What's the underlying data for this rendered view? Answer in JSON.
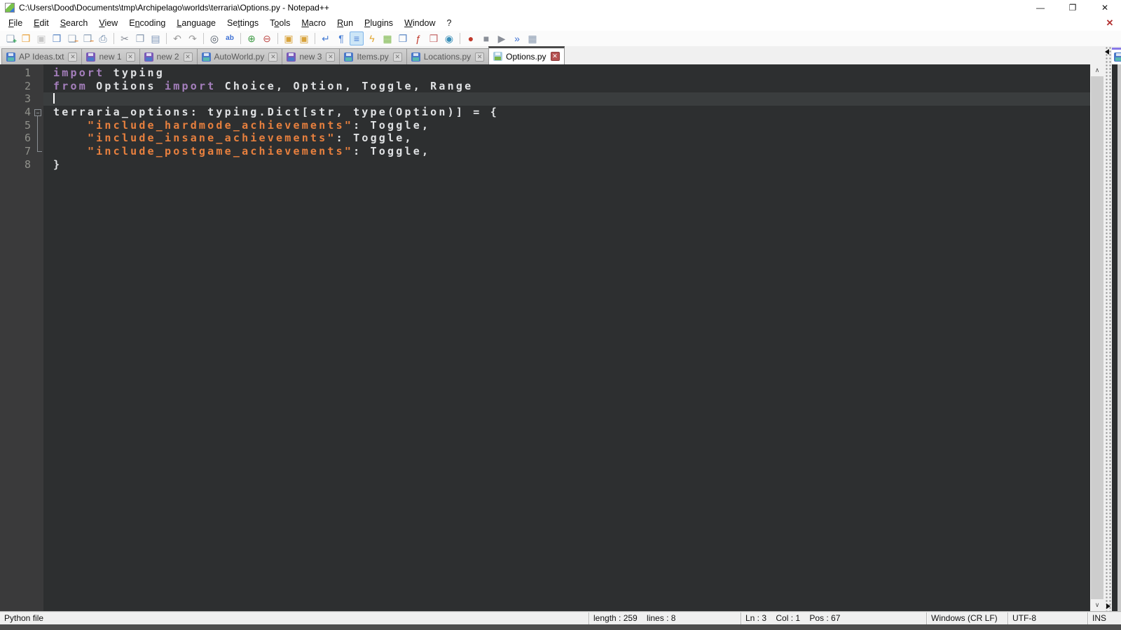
{
  "colors": {
    "editor_bg": "#2d2f30",
    "gutter_bg": "#3a3a3b",
    "caret_line_bg": "#3a3d3e",
    "keyword": "#a57fbd",
    "string": "#e8803e",
    "plain": "#e0e2e4",
    "line_number": "#90918b",
    "active_tab_top": "#4a4a4a",
    "secondary_tab_top": "#8878e8"
  },
  "titlebar": {
    "title": "C:\\Users\\Dood\\Documents\\tmp\\Archipelago\\worlds\\terraria\\Options.py - Notepad++",
    "minimize": "—",
    "restore": "❐",
    "close": "✕"
  },
  "menubar": {
    "items": [
      {
        "label": "File",
        "u": 0
      },
      {
        "label": "Edit",
        "u": 0
      },
      {
        "label": "Search",
        "u": 0
      },
      {
        "label": "View",
        "u": 0
      },
      {
        "label": "Encoding",
        "u": 1
      },
      {
        "label": "Language",
        "u": 0
      },
      {
        "label": "Settings",
        "u": 2
      },
      {
        "label": "Tools",
        "u": 1
      },
      {
        "label": "Macro",
        "u": 0
      },
      {
        "label": "Run",
        "u": 0
      },
      {
        "label": "Plugins",
        "u": 0
      },
      {
        "label": "Window",
        "u": 0
      },
      {
        "label": "?",
        "u": -1
      }
    ],
    "close_doc_glyph": "✕"
  },
  "toolbar": {
    "groups": [
      [
        {
          "name": "new-file-icon",
          "glyph": "❏",
          "color": "#8fa3b8",
          "ov": "+",
          "ovc": "#2fa84f"
        },
        {
          "name": "open-icon",
          "glyph": "❒",
          "color": "#e8a33d"
        },
        {
          "name": "save-icon",
          "glyph": "▣",
          "color": "#a0a0a0",
          "disabled": true
        },
        {
          "name": "save-all-icon",
          "glyph": "❒",
          "color": "#5b87c5"
        },
        {
          "name": "close-icon",
          "glyph": "❏",
          "color": "#8fa3b8",
          "ov": "−",
          "ovc": "#e8872e"
        },
        {
          "name": "close-all-icon",
          "glyph": "❒",
          "color": "#8fa3b8",
          "ov": "−",
          "ovc": "#e8872e"
        },
        {
          "name": "print-icon",
          "glyph": "⎙",
          "color": "#6b87a8"
        }
      ],
      [
        {
          "name": "cut-icon",
          "glyph": "✂",
          "color": "#8a8f98"
        },
        {
          "name": "copy-icon",
          "glyph": "❐",
          "color": "#8a9ab0"
        },
        {
          "name": "paste-icon",
          "glyph": "▤",
          "color": "#7f97b8"
        }
      ],
      [
        {
          "name": "undo-icon",
          "glyph": "↶",
          "color": "#9a9a9a"
        },
        {
          "name": "redo-icon",
          "glyph": "↷",
          "color": "#9a9a9a"
        }
      ],
      [
        {
          "name": "find-icon",
          "glyph": "◎",
          "color": "#4b5563"
        },
        {
          "name": "replace-icon",
          "glyph": "ab",
          "color": "#3b6fd4",
          "small": true
        }
      ],
      [
        {
          "name": "zoom-in-icon",
          "glyph": "⊕",
          "color": "#3f9b46"
        },
        {
          "name": "zoom-out-icon",
          "glyph": "⊖",
          "color": "#c0504d"
        }
      ],
      [
        {
          "name": "sync-vertical-scroll-icon",
          "glyph": "▣",
          "color": "#d8a23a"
        },
        {
          "name": "sync-horizontal-scroll-icon",
          "glyph": "▣",
          "color": "#d8a23a"
        }
      ],
      [
        {
          "name": "word-wrap-icon",
          "glyph": "↵",
          "color": "#4a7fd4"
        },
        {
          "name": "show-all-characters-icon",
          "glyph": "¶",
          "color": "#4a7fd4"
        },
        {
          "name": "indent-guide-icon",
          "glyph": "≡",
          "color": "#4a7fd4",
          "active": true
        },
        {
          "name": "style-configurator-icon",
          "glyph": "ϟ",
          "color": "#e0a52e"
        },
        {
          "name": "document-map-icon",
          "glyph": "▦",
          "color": "#7ab648"
        },
        {
          "name": "doc-switcher-icon",
          "glyph": "❐",
          "color": "#5b87c5"
        },
        {
          "name": "function-list-icon",
          "glyph": "ƒ",
          "color": "#c0392b"
        },
        {
          "name": "folder-as-workspace-icon",
          "glyph": "❒",
          "color": "#c66a6a"
        },
        {
          "name": "monitoring-icon",
          "glyph": "◉",
          "color": "#3a8fb8"
        }
      ],
      [
        {
          "name": "macro-record-icon",
          "glyph": "●",
          "color": "#c0392b"
        },
        {
          "name": "macro-stop-icon",
          "glyph": "■",
          "color": "#8a8f98"
        },
        {
          "name": "macro-play-icon",
          "glyph": "▶",
          "color": "#8a8f98"
        },
        {
          "name": "macro-run-multiple-icon",
          "glyph": "»",
          "color": "#3b6fd4"
        },
        {
          "name": "macro-save-icon",
          "glyph": "▦",
          "color": "#8a9ab0"
        }
      ]
    ]
  },
  "tabbar": {
    "tabs": [
      {
        "label": "AP Ideas.txt",
        "active": false,
        "floppy_body": "#4a78c8",
        "floppy_label": "#58b8b0"
      },
      {
        "label": "new 1",
        "active": false,
        "floppy_body": "#7a5ab8",
        "floppy_label": "#4a78c8"
      },
      {
        "label": "new 2",
        "active": false,
        "floppy_body": "#7a5ab8",
        "floppy_label": "#4a78c8"
      },
      {
        "label": "AutoWorld.py",
        "active": false,
        "floppy_body": "#4a78c8",
        "floppy_label": "#58b8b0"
      },
      {
        "label": "new 3",
        "active": false,
        "floppy_body": "#7a5ab8",
        "floppy_label": "#4a78c8"
      },
      {
        "label": "Items.py",
        "active": false,
        "floppy_body": "#4a78c8",
        "floppy_label": "#58b8b0"
      },
      {
        "label": "Locations.py",
        "active": false,
        "floppy_body": "#4a78c8",
        "floppy_label": "#58b8b0"
      },
      {
        "label": "Options.py",
        "active": true,
        "floppy_body": "#a8cce0",
        "floppy_label": "#7ab648"
      }
    ],
    "close_glyph": "✕"
  },
  "editor": {
    "lines": [
      {
        "num": "1",
        "segs": [
          {
            "t": "import",
            "c": "kw"
          },
          {
            "t": " typing",
            "c": "pl"
          }
        ]
      },
      {
        "num": "2",
        "segs": [
          {
            "t": "from",
            "c": "kw"
          },
          {
            "t": " Options ",
            "c": "pl"
          },
          {
            "t": "import",
            "c": "kw"
          },
          {
            "t": " Choice, Option, Toggle, Range",
            "c": "pl"
          }
        ]
      },
      {
        "num": "3",
        "segs": [],
        "caret": true
      },
      {
        "num": "4",
        "segs": [
          {
            "t": "terraria_options: typing.Dict[str, type(Option)] = {",
            "c": "pl"
          }
        ],
        "fold": "open"
      },
      {
        "num": "5",
        "segs": [
          {
            "t": "    ",
            "c": "pl"
          },
          {
            "t": "\"include_hardmode_achievements\"",
            "c": "str"
          },
          {
            "t": ": Toggle,",
            "c": "pl"
          }
        ]
      },
      {
        "num": "6",
        "segs": [
          {
            "t": "    ",
            "c": "pl"
          },
          {
            "t": "\"include_insane_achievements\"",
            "c": "str"
          },
          {
            "t": ": Toggle,",
            "c": "pl"
          }
        ]
      },
      {
        "num": "7",
        "segs": [
          {
            "t": "    ",
            "c": "pl"
          },
          {
            "t": "\"include_postgame_achievements\"",
            "c": "str"
          },
          {
            "t": ": Toggle,",
            "c": "pl"
          }
        ],
        "fold_end": true
      },
      {
        "num": "8",
        "segs": [
          {
            "t": "}",
            "c": "pl"
          }
        ]
      }
    ],
    "caret_line": 3
  },
  "scrollbar": {
    "up": "∧",
    "down": "∨"
  },
  "statusbar": {
    "doc_type": "Python file",
    "length_info": "length : 259    lines : 8",
    "position_info": "Ln : 3    Col : 1    Pos : 67",
    "eol_format": "Windows (CR LF)",
    "encoding": "UTF-8",
    "insert_mode": "INS"
  }
}
